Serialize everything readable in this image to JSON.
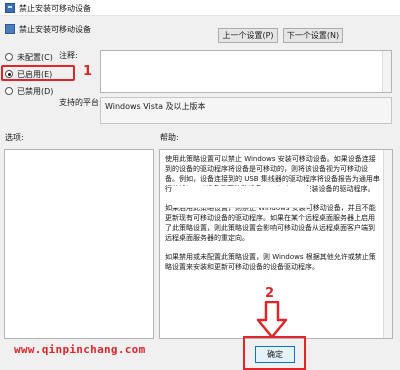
{
  "window": {
    "title": "禁止安装可移动设备"
  },
  "policy": {
    "name": "禁止安装可移动设备"
  },
  "nav": {
    "prev_label": "上一个设置(P)",
    "next_label": "下一个设置(N)"
  },
  "state": {
    "options": [
      {
        "label": "未配置(C)",
        "selected": false
      },
      {
        "label": "已启用(E)",
        "selected": true
      },
      {
        "label": "已禁用(D)",
        "selected": false
      }
    ]
  },
  "comment": {
    "label": "注释:",
    "value": ""
  },
  "platform": {
    "label": "支持的平台:",
    "value": "Windows Vista 及以上版本"
  },
  "sections": {
    "options_label": "选项:",
    "help_label": "帮助:"
  },
  "help": {
    "paragraphs": [
      "使用此策略设置可以禁止 Windows 安装可移动设备。如果设备连接到的设备的驱动程序将设备是可移动的，则将该设备视为可移动设备。例如，设备连接到的 USB 集线器的驱动程序将设备报告为通用串行总线(USB)设备是可移动设备。 Windows 安装设备的驱动程序。",
      "如果启用此策略设置，则禁止 Windows 安装可移动设备，并且不能更新现有可移动设备的驱动程序。如果在某个远程桌面服务器上启用了此策略设置，则此策略设置会影响可移动设备从远程桌面客户端到远程桌面服务器的重定向。",
      "如果禁用或未配置此策略设置，则 Windows 根据其他允许或禁止策略设置来安装和更新可移动设备的设备驱动程序。"
    ]
  },
  "buttons": {
    "ok_label": "确定"
  },
  "annotations": {
    "step1": "1",
    "step2": "2",
    "color": "#e3242b"
  },
  "watermark": "www.qinpinchang.com"
}
